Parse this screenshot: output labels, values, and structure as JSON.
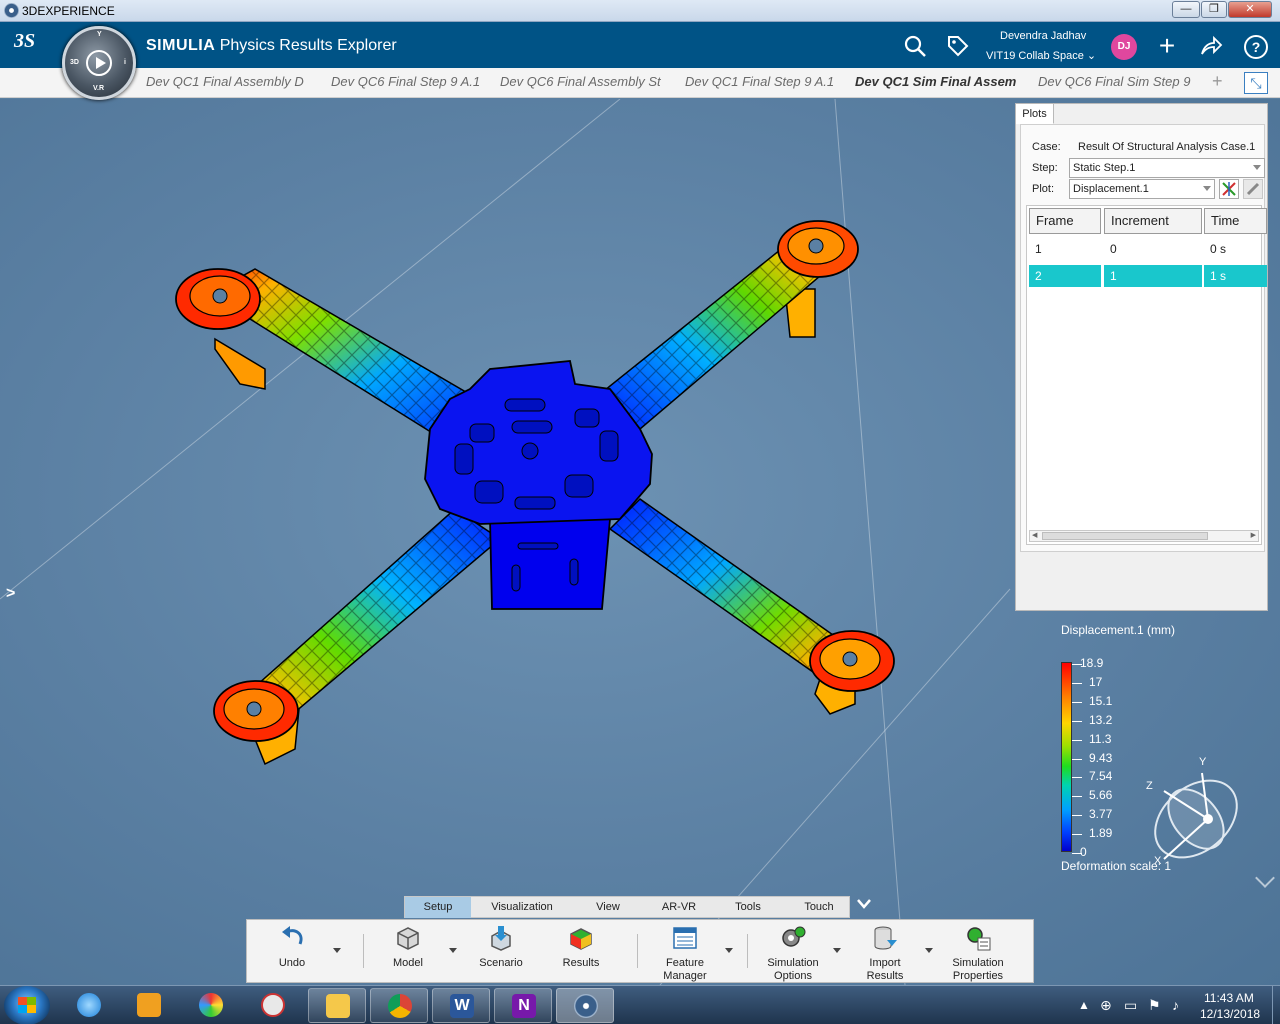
{
  "window": {
    "title": "3DEXPERIENCE"
  },
  "header": {
    "brand": "SIMULIA",
    "app_name": "Physics Results Explorer",
    "user_name": "Devendra Jadhav",
    "collab_space": "VIT19 Collab Space",
    "avatar_initials": "DJ",
    "compass_labels": {
      "top": "Y",
      "left": "3D",
      "right": "i",
      "bottom": "V.R"
    }
  },
  "tabs": [
    {
      "label": "Dev QC1 Final Assembly D",
      "active": false
    },
    {
      "label": "Dev QC6 Final Step 9 A.1",
      "active": false
    },
    {
      "label": "Dev QC6 Final Assembly St",
      "active": false
    },
    {
      "label": "Dev QC1 Final Step 9 A.1",
      "active": false
    },
    {
      "label": "Dev QC1 Sim Final Assem",
      "active": true
    },
    {
      "label": "Dev QC6 Final Sim Step 9",
      "active": false
    }
  ],
  "plots_panel": {
    "tab_label": "Plots",
    "case_label": "Case:",
    "case_value": "Result Of Structural Analysis Case.1",
    "step_label": "Step:",
    "step_value": "Static Step.1",
    "plot_label": "Plot:",
    "plot_value": "Displacement.1",
    "columns": [
      "Frame",
      "Increment",
      "Time"
    ],
    "rows": [
      {
        "frame": "1",
        "increment": "0",
        "time": "0 s",
        "selected": false
      },
      {
        "frame": "2",
        "increment": "1",
        "time": "1 s",
        "selected": true
      }
    ]
  },
  "legend": {
    "title": "Displacement.1 (mm)",
    "values": [
      "18.9",
      "17",
      "15.1",
      "13.2",
      "11.3",
      "9.43",
      "7.54",
      "5.66",
      "3.77",
      "1.89",
      "0"
    ],
    "deformation_scale": "Deformation scale: 1"
  },
  "axis_triad": {
    "x": "X",
    "y": "Y",
    "z": "Z"
  },
  "ribbon": {
    "tabs": [
      {
        "label": "Setup",
        "active": true
      },
      {
        "label": "Visualization",
        "active": false
      },
      {
        "label": "View",
        "active": false
      },
      {
        "label": "AR-VR",
        "active": false
      },
      {
        "label": "Tools",
        "active": false
      },
      {
        "label": "Touch",
        "active": false
      }
    ],
    "buttons": {
      "undo": "Undo",
      "model": "Model",
      "scenario": "Scenario",
      "results": "Results",
      "feature_manager_1": "Feature",
      "feature_manager_2": "Manager",
      "sim_options_1": "Simulation",
      "sim_options_2": "Options",
      "import_results_1": "Import",
      "import_results_2": "Results",
      "sim_properties_1": "Simulation",
      "sim_properties_2": "Properties"
    }
  },
  "taskbar": {
    "time": "11:43 AM",
    "date": "12/13/2018",
    "apps": [
      "internet-explorer",
      "media-player",
      "paint",
      "snipping-tool",
      "file-explorer",
      "chrome",
      "word",
      "onenote",
      "3dexperience"
    ]
  },
  "colors": {
    "header": "#005386",
    "viewport": "#5b80a3",
    "selected_row": "#19c7cc",
    "accent": "#3a7fc1"
  }
}
